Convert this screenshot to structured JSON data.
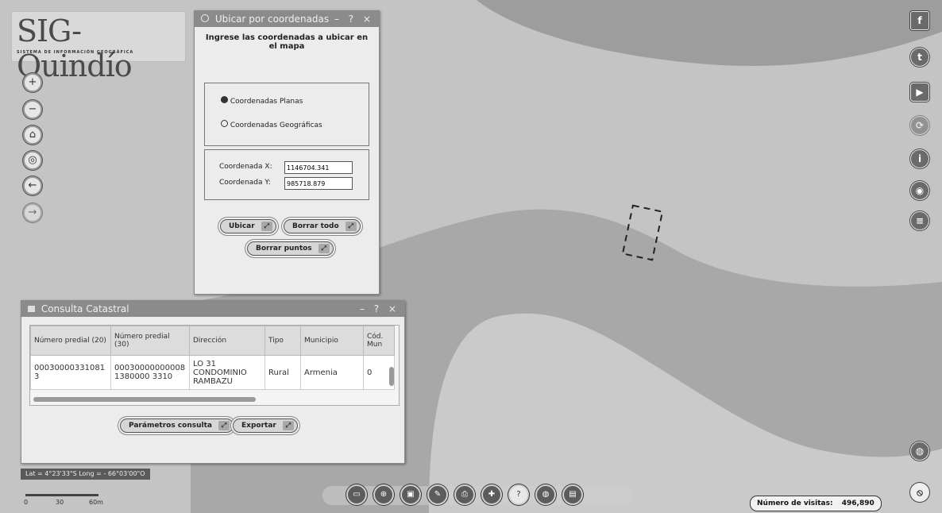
{
  "logo": {
    "title": "SIG-Quindío",
    "subtitle": "SISTEMA DE INFORMACIÓN GEOGRÁFICA"
  },
  "nav": [
    {
      "icon": "plus-icon",
      "glyph": "+"
    },
    {
      "icon": "minus-icon",
      "glyph": "−"
    },
    {
      "icon": "home-icon",
      "glyph": "⌂"
    },
    {
      "icon": "locate-icon",
      "glyph": "◎"
    },
    {
      "icon": "arrow-left-icon",
      "glyph": "←"
    },
    {
      "icon": "arrow-right-icon",
      "glyph": "→"
    }
  ],
  "coord_dialog": {
    "title": "Ubicar por coordenadas",
    "controls": "– ? ×",
    "heading": "Ingrese las coordenadas a ubicar en el mapa",
    "radio_planas": "Coordenadas Planas",
    "radio_geo": "Coordenadas Geográficas",
    "x_label": "Coordenada X:",
    "x_value": "1146704.341",
    "y_label": "Coordenada Y:",
    "y_value": "985718.879",
    "btn_ubicar": "Ubicar",
    "btn_borrar_todo": "Borrar todo",
    "btn_borrar_puntos": "Borrar puntos"
  },
  "cadastral": {
    "title": "Consulta Catastral",
    "controls": "– ? ×",
    "headers": [
      "Número predial (20)",
      "Número predial (30)",
      "Dirección",
      "Tipo",
      "Municipio",
      "Cód. Mun"
    ],
    "row": [
      "000300003310813",
      "000300000000081380000 3310",
      "LO 31 CONDOMINIO RAMBAZU",
      "Rural",
      "Armenia",
      "0"
    ],
    "btn_params": "Parámetros consulta",
    "btn_export": "Exportar"
  },
  "status": {
    "latlong": "Lat = 4°23'33\"S Long = - 66°03'00\"O",
    "scale": [
      "0",
      "30",
      "60m"
    ]
  },
  "social": [
    {
      "icon": "facebook-icon",
      "glyph": "f"
    },
    {
      "icon": "twitter-icon",
      "glyph": "t"
    },
    {
      "icon": "youtube-icon",
      "glyph": "▶"
    },
    {
      "icon": "share-icon",
      "glyph": "⟳"
    },
    {
      "icon": "info-icon",
      "glyph": "i"
    },
    {
      "icon": "layers-icon",
      "glyph": "◉"
    },
    {
      "icon": "list-icon",
      "glyph": "≡"
    }
  ],
  "tools": [
    {
      "icon": "measure-icon",
      "glyph": "▭"
    },
    {
      "icon": "zoom-box-icon",
      "glyph": "⊕"
    },
    {
      "icon": "select-icon",
      "glyph": "▣"
    },
    {
      "icon": "draw-icon",
      "glyph": "✎"
    },
    {
      "icon": "print-icon",
      "glyph": "⎙"
    },
    {
      "icon": "coordinates-icon",
      "glyph": "✚"
    },
    {
      "icon": "identify-icon",
      "glyph": "?"
    },
    {
      "icon": "globe-icon",
      "glyph": "◍"
    },
    {
      "icon": "table-icon",
      "glyph": "▤"
    }
  ],
  "visits": {
    "label": "Número de visitas:",
    "value": "496,890"
  }
}
